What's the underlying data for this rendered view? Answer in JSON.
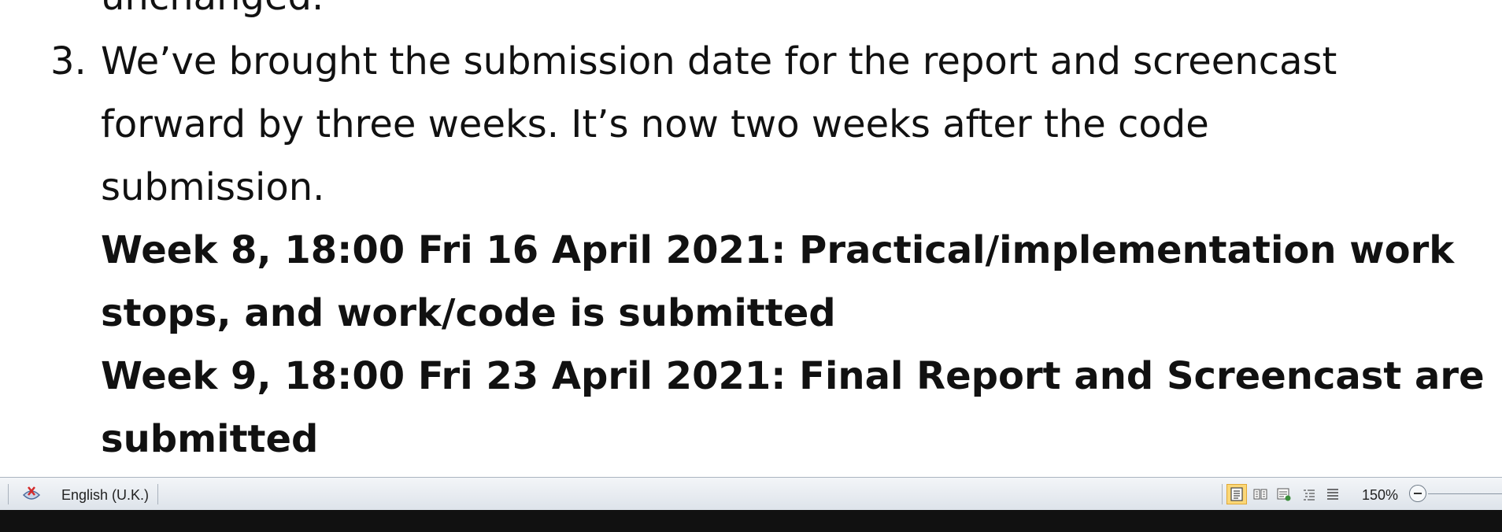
{
  "document": {
    "line_top_partial": "unchanged.",
    "item_number": "3.",
    "item_line1": "We’ve brought the submission date for the report and screencast",
    "item_line2": "forward by three weeks. It’s now two weeks after the code",
    "item_line3": "submission.",
    "bold_line1": "Week 8, 18:00 Fri 16 April 2021: Practical/implementation work",
    "bold_line2": "stops, and work/code is submitted",
    "bold_line3": "Week 9, 18:00 Fri 23 April 2021: Final Report and Screencast are",
    "bold_line4": "submitted"
  },
  "status_bar": {
    "language": "English (U.K.)",
    "zoom_level": "150%",
    "icons": [
      "proofing-icon",
      "print-layout-icon",
      "full-screen-reading-icon",
      "web-layout-icon",
      "outline-icon",
      "draft-icon",
      "zoom-out-icon"
    ]
  },
  "colors": {
    "active_view_fill": "#fbd777",
    "active_view_border": "#e0a838"
  }
}
